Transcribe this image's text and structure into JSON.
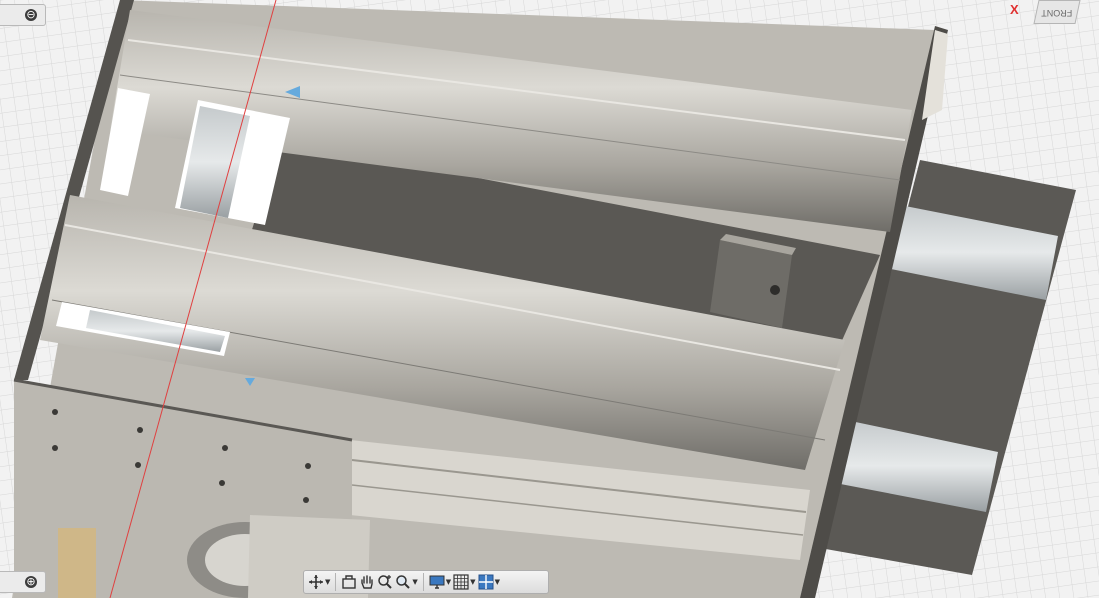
{
  "app": {
    "name": "Fusion 360 CAD viewport"
  },
  "browser_panel": {
    "toggle_glyph": "⊖"
  },
  "comments_panel": {
    "toggle_glyph": "⊕"
  },
  "viewcube": {
    "face_label": "FRONT",
    "x_axis_label": "X"
  },
  "navigation_bar": {
    "tools": [
      {
        "name": "orbit",
        "icon": "orbit-icon",
        "has_dropdown": true
      },
      {
        "name": "look-at",
        "icon": "look-at-icon",
        "has_dropdown": false
      },
      {
        "name": "pan",
        "icon": "hand-icon",
        "has_dropdown": false
      },
      {
        "name": "zoom",
        "icon": "zoom-icon",
        "has_dropdown": false
      },
      {
        "name": "fit",
        "icon": "zoom-window-icon",
        "has_dropdown": true
      },
      {
        "name": "display-settings",
        "icon": "monitor-icon",
        "has_dropdown": true
      },
      {
        "name": "grid-and-snaps",
        "icon": "grid-icon",
        "has_dropdown": true
      },
      {
        "name": "viewports",
        "icon": "viewports-icon",
        "has_dropdown": true
      }
    ]
  },
  "colors": {
    "grid_bg": "#f2f2f2",
    "model_light": "#c9c6bf",
    "model_dark": "#5a5854",
    "axis_line": "#e04040",
    "accent": "#3a78c0"
  }
}
